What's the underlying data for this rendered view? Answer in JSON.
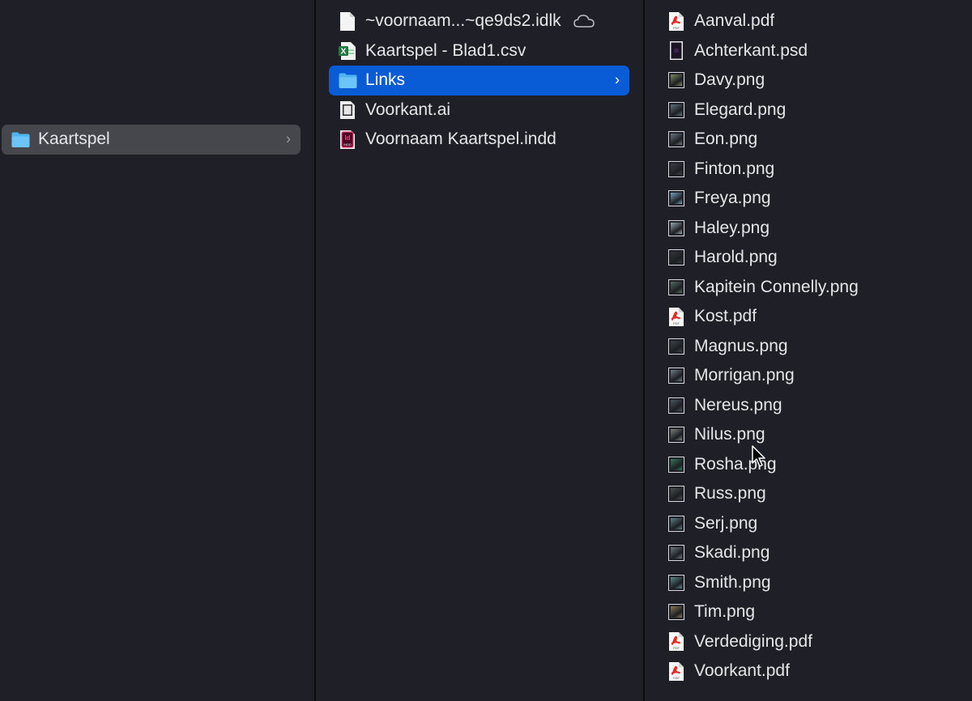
{
  "columns": [
    {
      "items": [
        {
          "name": "Kaartspel",
          "icon": "folder-icon",
          "selected": "inactive",
          "has_children": true
        }
      ]
    },
    {
      "items": [
        {
          "name": "~voornaam...~qe9ds2.idlk",
          "icon": "generic-document-icon",
          "cloud": true
        },
        {
          "name": "Kaartspel - Blad1.csv",
          "icon": "excel-icon"
        },
        {
          "name": "Links",
          "icon": "folder-icon",
          "selected": "active",
          "has_children": true
        },
        {
          "name": "Voorkant.ai",
          "icon": "illustrator-icon"
        },
        {
          "name": "Voornaam Kaartspel.indd",
          "icon": "indesign-icon"
        }
      ]
    },
    {
      "items": [
        {
          "name": "Aanval.pdf",
          "icon": "pdf-icon"
        },
        {
          "name": "Achterkant.psd",
          "icon": "psd-icon"
        },
        {
          "name": "Davy.png",
          "icon": "image-thumbnail-icon",
          "tint": "#7f8a63"
        },
        {
          "name": "Elegard.png",
          "icon": "image-thumbnail-icon",
          "tint": "#5e7481"
        },
        {
          "name": "Eon.png",
          "icon": "image-thumbnail-icon",
          "tint": "#6c7783"
        },
        {
          "name": "Finton.png",
          "icon": "image-thumbnail-icon",
          "tint": "#3c4148"
        },
        {
          "name": "Freya.png",
          "icon": "image-thumbnail-icon",
          "tint": "#7aa2c0"
        },
        {
          "name": "Haley.png",
          "icon": "image-thumbnail-icon",
          "tint": "#98a7b3"
        },
        {
          "name": "Harold.png",
          "icon": "image-thumbnail-icon",
          "tint": "#33383d"
        },
        {
          "name": "Kapitein Connelly.png",
          "icon": "image-thumbnail-icon",
          "tint": "#556b5f"
        },
        {
          "name": "Kost.pdf",
          "icon": "pdf-icon"
        },
        {
          "name": "Magnus.png",
          "icon": "image-thumbnail-icon",
          "tint": "#3f444a"
        },
        {
          "name": "Morrigan.png",
          "icon": "image-thumbnail-icon",
          "tint": "#6f7c88"
        },
        {
          "name": "Nereus.png",
          "icon": "image-thumbnail-icon",
          "tint": "#4b5560"
        },
        {
          "name": "Nilus.png",
          "icon": "image-thumbnail-icon",
          "tint": "#7c837a"
        },
        {
          "name": "Rosha.png",
          "icon": "image-thumbnail-icon",
          "tint": "#2f7a5c"
        },
        {
          "name": "Russ.png",
          "icon": "image-thumbnail-icon",
          "tint": "#4a4f50"
        },
        {
          "name": "Serj.png",
          "icon": "image-thumbnail-icon",
          "tint": "#5f7f86"
        },
        {
          "name": "Skadi.png",
          "icon": "image-thumbnail-icon",
          "tint": "#717a82"
        },
        {
          "name": "Smith.png",
          "icon": "image-thumbnail-icon",
          "tint": "#5d8a8e"
        },
        {
          "name": "Tim.png",
          "icon": "image-thumbnail-icon",
          "tint": "#8a7a52"
        },
        {
          "name": "Verdediging.pdf",
          "icon": "pdf-icon"
        },
        {
          "name": "Voorkant.pdf",
          "icon": "pdf-icon"
        }
      ]
    }
  ],
  "colors": {
    "background": "#1f2027",
    "selection_active": "#0a5bd6",
    "selection_inactive": "#46474c",
    "folder_blue": "#4fb3f2",
    "pdf_red": "#e3271f",
    "excel_green": "#1f7a43",
    "indesign_pink": "#ff3d7a"
  }
}
